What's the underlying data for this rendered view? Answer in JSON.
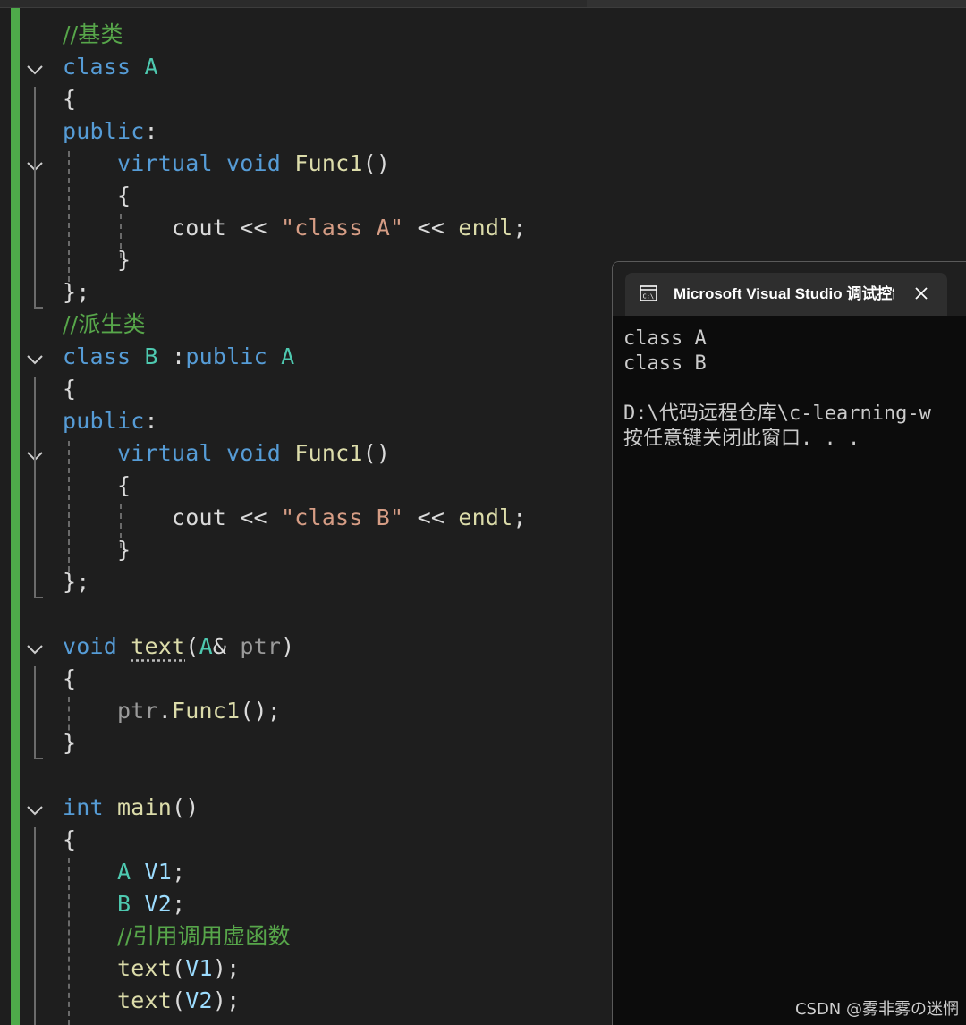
{
  "editor": {
    "lines": [
      [
        {
          "t": "//基类",
          "c": "cm"
        }
      ],
      [
        {
          "t": "class",
          "c": "kw"
        },
        {
          "t": " "
        },
        {
          "t": "A",
          "c": "ty"
        }
      ],
      [
        {
          "t": "{",
          "c": "pl"
        }
      ],
      [
        {
          "t": "public",
          "c": "kw"
        },
        {
          "t": ":",
          "c": "pl"
        }
      ],
      [
        {
          "t": "    "
        },
        {
          "t": "virtual",
          "c": "kw"
        },
        {
          "t": " "
        },
        {
          "t": "void",
          "c": "kw"
        },
        {
          "t": " "
        },
        {
          "t": "Func1",
          "c": "fn"
        },
        {
          "t": "()",
          "c": "pl"
        }
      ],
      [
        {
          "t": "    "
        },
        {
          "t": "{",
          "c": "pl"
        }
      ],
      [
        {
          "t": "        "
        },
        {
          "t": "cout",
          "c": "pl"
        },
        {
          "t": " << ",
          "c": "pl"
        },
        {
          "t": "\"class A\"",
          "c": "st"
        },
        {
          "t": " << ",
          "c": "pl"
        },
        {
          "t": "endl",
          "c": "fn"
        },
        {
          "t": ";",
          "c": "pl"
        }
      ],
      [
        {
          "t": "    "
        },
        {
          "t": "}",
          "c": "pl"
        }
      ],
      [
        {
          "t": "};",
          "c": "pl"
        }
      ],
      [
        {
          "t": "//派生类",
          "c": "cm"
        }
      ],
      [
        {
          "t": "class",
          "c": "kw"
        },
        {
          "t": " "
        },
        {
          "t": "B",
          "c": "ty"
        },
        {
          "t": " :",
          "c": "pl"
        },
        {
          "t": "public",
          "c": "kw"
        },
        {
          "t": " "
        },
        {
          "t": "A",
          "c": "ty"
        }
      ],
      [
        {
          "t": "{",
          "c": "pl"
        }
      ],
      [
        {
          "t": "public",
          "c": "kw"
        },
        {
          "t": ":",
          "c": "pl"
        }
      ],
      [
        {
          "t": "    "
        },
        {
          "t": "virtual",
          "c": "kw"
        },
        {
          "t": " "
        },
        {
          "t": "void",
          "c": "kw"
        },
        {
          "t": " "
        },
        {
          "t": "Func1",
          "c": "fn"
        },
        {
          "t": "()",
          "c": "pl"
        }
      ],
      [
        {
          "t": "    "
        },
        {
          "t": "{",
          "c": "pl"
        }
      ],
      [
        {
          "t": "        "
        },
        {
          "t": "cout",
          "c": "pl"
        },
        {
          "t": " << ",
          "c": "pl"
        },
        {
          "t": "\"class B\"",
          "c": "st"
        },
        {
          "t": " << ",
          "c": "pl"
        },
        {
          "t": "endl",
          "c": "fn"
        },
        {
          "t": ";",
          "c": "pl"
        }
      ],
      [
        {
          "t": "    "
        },
        {
          "t": "}",
          "c": "pl"
        }
      ],
      [
        {
          "t": "};",
          "c": "pl"
        }
      ],
      [],
      [
        {
          "t": "void",
          "c": "kw"
        },
        {
          "t": " "
        },
        {
          "t": "text",
          "c": "fn",
          "u": true
        },
        {
          "t": "(",
          "c": "pl"
        },
        {
          "t": "A",
          "c": "ty"
        },
        {
          "t": "& ",
          "c": "pl"
        },
        {
          "t": "ptr",
          "c": "pr"
        },
        {
          "t": ")",
          "c": "pl"
        }
      ],
      [
        {
          "t": "{",
          "c": "pl"
        }
      ],
      [
        {
          "t": "    "
        },
        {
          "t": "ptr",
          "c": "pr"
        },
        {
          "t": ".",
          "c": "pl"
        },
        {
          "t": "Func1",
          "c": "fn"
        },
        {
          "t": "();",
          "c": "pl"
        }
      ],
      [
        {
          "t": "}",
          "c": "pl"
        }
      ],
      [],
      [
        {
          "t": "int",
          "c": "kw"
        },
        {
          "t": " "
        },
        {
          "t": "main",
          "c": "fn"
        },
        {
          "t": "()",
          "c": "pl"
        }
      ],
      [
        {
          "t": "{",
          "c": "pl"
        }
      ],
      [
        {
          "t": "    "
        },
        {
          "t": "A",
          "c": "ty"
        },
        {
          "t": " "
        },
        {
          "t": "V1",
          "c": "vr"
        },
        {
          "t": ";",
          "c": "pl"
        }
      ],
      [
        {
          "t": "    "
        },
        {
          "t": "B",
          "c": "ty"
        },
        {
          "t": " "
        },
        {
          "t": "V2",
          "c": "vr"
        },
        {
          "t": ";",
          "c": "pl"
        }
      ],
      [
        {
          "t": "    "
        },
        {
          "t": "//引用调用虚函数",
          "c": "cm"
        }
      ],
      [
        {
          "t": "    "
        },
        {
          "t": "text",
          "c": "fn"
        },
        {
          "t": "(",
          "c": "pl"
        },
        {
          "t": "V1",
          "c": "vr"
        },
        {
          "t": ");",
          "c": "pl"
        }
      ],
      [
        {
          "t": "    "
        },
        {
          "t": "text",
          "c": "fn"
        },
        {
          "t": "(",
          "c": "pl"
        },
        {
          "t": "V2",
          "c": "vr"
        },
        {
          "t": ");",
          "c": "pl"
        }
      ]
    ]
  },
  "console": {
    "title": "Microsoft Visual Studio 调试控制台",
    "icon": "console-app-icon",
    "close_icon": "close-icon",
    "lines": [
      "class A",
      "class B",
      "",
      "D:\\代码远程仓库\\c-learning-w",
      "按任意键关闭此窗口. . ."
    ]
  },
  "watermark": "CSDN @雾非雾の迷惘",
  "colors": {
    "keyword": "#569cd6",
    "type": "#4ec9b0",
    "function": "#dcdcaa",
    "string": "#d69d85",
    "comment": "#57a64a",
    "change_bar": "#4eaa4a",
    "background": "#1e1e1e"
  }
}
